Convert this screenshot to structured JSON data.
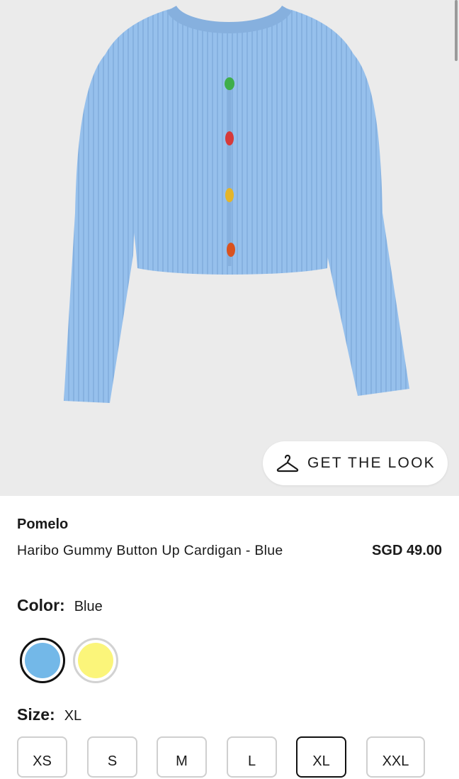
{
  "look_button": {
    "label": "GET THE LOOK",
    "icon": "hanger-icon"
  },
  "product": {
    "brand": "Pomelo",
    "name": "Haribo Gummy Button Up Cardigan - Blue",
    "price": "SGD 49.00"
  },
  "color": {
    "label": "Color:",
    "selected": "Blue",
    "swatches": [
      {
        "name": "Blue",
        "hex": "#73b8e8",
        "selected": true
      },
      {
        "name": "Yellow",
        "hex": "#fbf57a",
        "selected": false
      }
    ]
  },
  "size": {
    "label": "Size:",
    "selected": "XL",
    "options": [
      "XS",
      "S",
      "M",
      "L",
      "XL",
      "XXL"
    ]
  },
  "colors": {
    "hero_background": "#ebebeb",
    "cardigan": "#96c0ec",
    "selected_border": "#111111"
  }
}
